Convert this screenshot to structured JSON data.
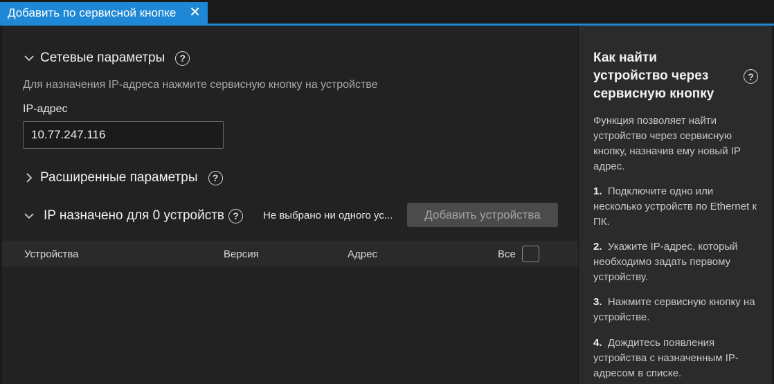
{
  "tab": {
    "title": "Добавить по сервисной кнопке",
    "close": "✕"
  },
  "network": {
    "title": "Сетевые параметры",
    "hint": "Для назначения IP-адреса нажмите сервисную кнопку на устройстве",
    "ip_label": "IP-адрес",
    "ip_value": "10.77.247.116"
  },
  "advanced": {
    "title": "Расширенные параметры"
  },
  "assigned": {
    "title": "IP назначено для 0 устройств",
    "selection_status": "Не выбрано ни одного ус...",
    "add_button": "Добавить устройства"
  },
  "table": {
    "columns": [
      "Устройства",
      "Версия",
      "Адрес",
      "Все"
    ]
  },
  "help_glyph": "?",
  "sidebar": {
    "title": "Как найти устройство через сервисную кнопку",
    "intro": "Функция позволяет найти устройство через сервисную кнопку, назначив ему новый IP адрес.",
    "steps": [
      {
        "num": "1.",
        "text": "Подключите одно или несколько устройств по Ethernet к ПК."
      },
      {
        "num": "2.",
        "text": "Укажите IP-адрес, который необходимо задать первому устройству."
      },
      {
        "num": "3.",
        "text": "Нажмите сервисную кнопку на устройстве."
      },
      {
        "num": "4.",
        "text": "Дождитесь появления устройства с назначенным IP-адресом в списке."
      }
    ]
  },
  "colors": {
    "accent": "#1e88d6",
    "panel": "#222222",
    "sidebar": "#2b2b2b"
  }
}
